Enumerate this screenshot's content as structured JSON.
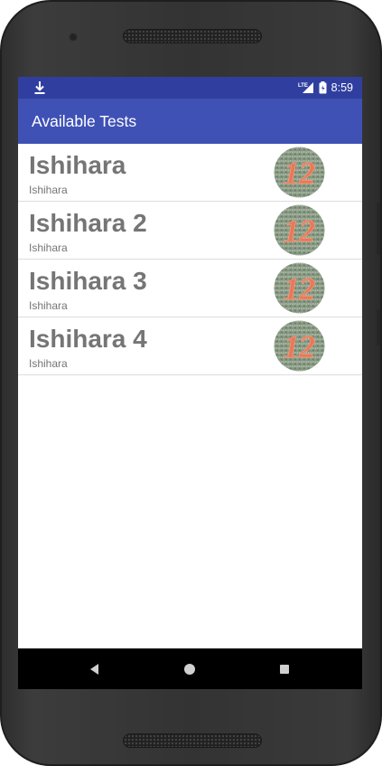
{
  "status_bar": {
    "time": "8:59",
    "network": "LTE",
    "background_color": "#303f9f",
    "icons": [
      "download-icon",
      "signal-icon",
      "battery-icon"
    ]
  },
  "app_bar": {
    "title": "Available Tests",
    "background_color": "#3f51b5"
  },
  "tests": [
    {
      "title": "Ishihara",
      "subtitle": "Ishihara",
      "plate_number": "12"
    },
    {
      "title": "Ishihara 2",
      "subtitle": "Ishihara",
      "plate_number": "12"
    },
    {
      "title": "Ishihara 3",
      "subtitle": "Ishihara",
      "plate_number": "12"
    },
    {
      "title": "Ishihara 4",
      "subtitle": "Ishihara",
      "plate_number": "12"
    }
  ],
  "nav_bar": {
    "buttons": [
      "back-icon",
      "home-icon",
      "recents-icon"
    ]
  }
}
